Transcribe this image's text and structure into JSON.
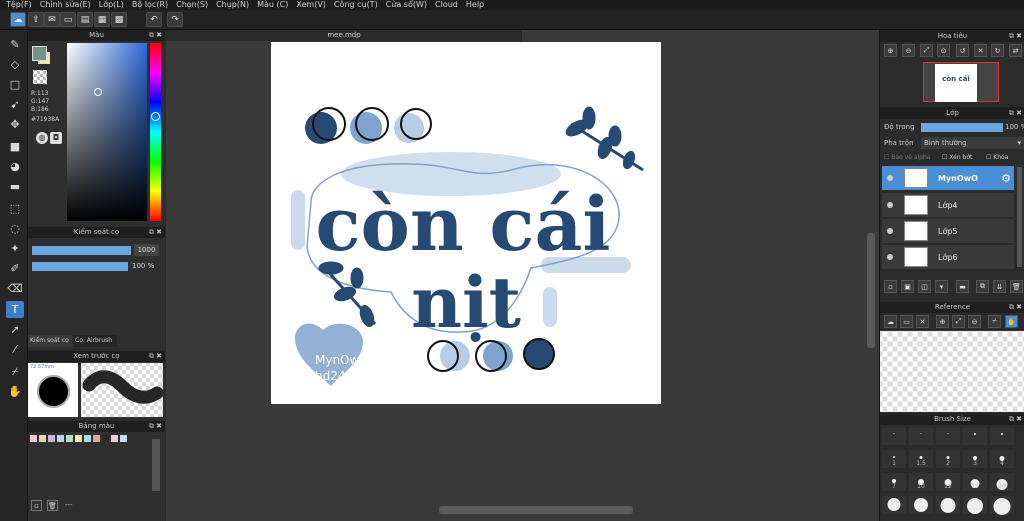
{
  "menu": [
    "Tệp(F)",
    "Chỉnh sửa(E)",
    "Lớp(L)",
    "Bộ lọc(R)",
    "Chọn(S)",
    "Chụp(N)",
    "Màu (C)",
    "Xem(V)",
    "Công cụ(T)",
    "Cửa sổ(W)",
    "Cloud",
    "Help"
  ],
  "document": {
    "tab_title": "mee.mdp"
  },
  "color_panel": {
    "title": "Màu",
    "r": "R:113",
    "g": "G:147",
    "b": "B:186",
    "hex": "#71938A",
    "fg_color": "#71938a",
    "bg_color": "#f5e6b0"
  },
  "brush_control": {
    "title": "Kiểm soát cọ",
    "size_value": "1000",
    "opacity_value": "100 %",
    "tab1": "Kiểm soát cọ",
    "tab2": "Cọ: Airbrush"
  },
  "brush_preview": {
    "title": "Xem trước cọ",
    "size_label": "72.57mm"
  },
  "palette": {
    "title": "Bảng màu",
    "swatches": [
      "#f4c7d4",
      "#f2d1b3",
      "#c9b6e0",
      "#b6d3f2",
      "#b6e0c9",
      "#f2e6a6",
      "#a6e0e0",
      "#e0a6a6",
      "#2a2a2a",
      "#f2c9e0",
      "#c9e0f2"
    ],
    "bottom_label": "---"
  },
  "artwork": {
    "line1": "còn cái",
    "line2": "nịt",
    "signature1": "MynOwO",
    "signature2": "hd247",
    "primary_color": "#264a73",
    "light_color": "#7fa3cc"
  },
  "navigator": {
    "title": "Hoa tiêu"
  },
  "layers": {
    "title": "Lớp",
    "opacity_label": "Độ trong",
    "opacity_value": "100 %",
    "blend_label": "Pha trộn",
    "blend_value": "Bình thường",
    "protect_alpha": "Bảo vệ alpha",
    "clipping": "Xén bớt",
    "lock": "Khóa",
    "items": [
      {
        "name": "MynOwO",
        "selected": true
      },
      {
        "name": "Lớp4",
        "selected": false
      },
      {
        "name": "Lớp5",
        "selected": false
      },
      {
        "name": "Lớp6",
        "selected": false
      }
    ]
  },
  "reference": {
    "title": "Reference"
  },
  "brush_size": {
    "title": "Brush Size",
    "labels_row1": [
      "1",
      "1.5",
      "2",
      "3",
      "4"
    ],
    "labels_row2": [
      "7",
      "10",
      "12",
      "15",
      "20"
    ]
  }
}
